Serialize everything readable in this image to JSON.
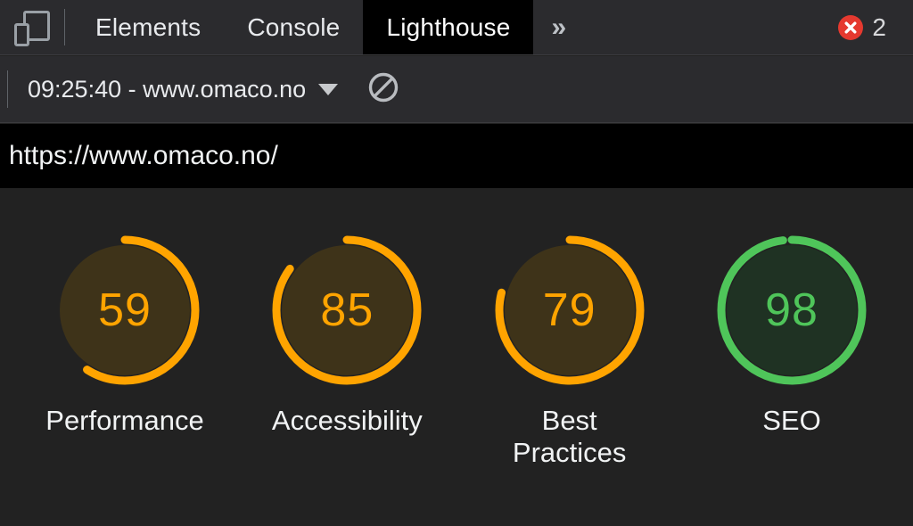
{
  "tabbar": {
    "device_toolbar_icon": "device-toolbar-icon",
    "tabs": [
      {
        "label": "Elements",
        "active": false
      },
      {
        "label": "Console",
        "active": false
      },
      {
        "label": "Lighthouse",
        "active": true
      }
    ],
    "overflow_label": "»",
    "error_badge": {
      "icon": "error-circle-icon",
      "count": "2"
    }
  },
  "runbar": {
    "run_selector_label": "09:25:40 - www.omaco.no",
    "caret_icon": "chevron-down-icon",
    "clear_icon": "no-entry-clear-icon"
  },
  "urlbar": {
    "url": "https://www.omaco.no/"
  },
  "report": {
    "colors": {
      "orange": "#ffa400",
      "orange_fill": "#3e3319",
      "green": "#4fc55a",
      "green_fill": "#1f3223",
      "background": "#222222",
      "label_text": "#f1f3f4"
    },
    "gauges": [
      {
        "score": "59",
        "label": "Performance",
        "percent": 59,
        "status": "average",
        "color": "#ffa400",
        "fill": "#3e3319"
      },
      {
        "score": "85",
        "label": "Accessibility",
        "percent": 85,
        "status": "average",
        "color": "#ffa400",
        "fill": "#3e3319"
      },
      {
        "score": "79",
        "label": "Best Practices",
        "percent": 79,
        "status": "average",
        "color": "#ffa400",
        "fill": "#3e3319"
      },
      {
        "score": "98",
        "label": "SEO",
        "percent": 98,
        "status": "good",
        "color": "#4fc55a",
        "fill": "#1f3223"
      }
    ]
  }
}
